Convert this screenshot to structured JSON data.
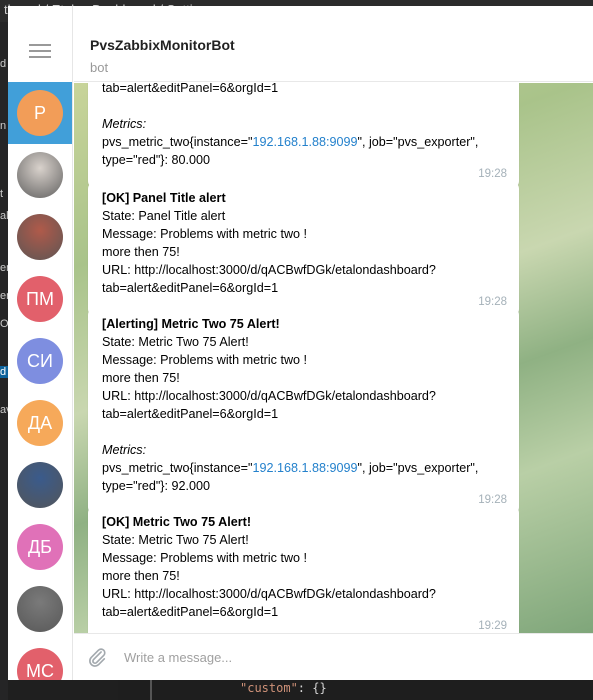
{
  "background": {
    "titlebar_text": "tboard / Etalon Dashboard / Setti",
    "edge_letters": [
      "d",
      "n",
      "t",
      "al",
      "er",
      "er",
      "O",
      "d",
      "av"
    ],
    "code_key": "\"custom\"",
    "code_punct": ": {}"
  },
  "chat": {
    "title": "PvsZabbixMonitorBot",
    "subtitle": "bot"
  },
  "sidebar": {
    "items": [
      {
        "initials": "P",
        "color": "#f29d58",
        "active": true
      },
      {
        "initials": "",
        "color": "#d9d2cc",
        "photo": "photo-hands"
      },
      {
        "initials": "",
        "color": "#b05a4a",
        "photo": "photo-person-sunglasses"
      },
      {
        "initials": "ПМ",
        "color": "#e2606b"
      },
      {
        "initials": "СИ",
        "color": "#7e8ee0"
      },
      {
        "initials": "ДА",
        "color": "#f6a95a"
      },
      {
        "initials": "",
        "color": "#3a5b8c",
        "photo": "photo-person-suit"
      },
      {
        "initials": "ДБ",
        "color": "#e071b8"
      },
      {
        "initials": "",
        "color": "#7a7a7a",
        "photo": "photo-grey-room"
      },
      {
        "initials": "МС",
        "color": "#e2606b"
      }
    ]
  },
  "messages": [
    {
      "lines": [
        {
          "text": "tab=alert&editPanel=6&orgId=1",
          "style": "normal"
        },
        {
          "text": "",
          "style": "spacer"
        },
        {
          "text": "Metrics:",
          "style": "italic"
        },
        {
          "text": "pvs_metric_two{instance=\"",
          "style": "metric",
          "link": "192.168.1.88:9099",
          "rest": "\", job=\"pvs_exporter\","
        },
        {
          "text": "type=\"red\"}: 80.000",
          "style": "normal"
        }
      ],
      "time": "19:28"
    },
    {
      "lines": [
        {
          "text": "[OK] Panel Title alert",
          "style": "bold"
        },
        {
          "text": "State: Panel Title alert",
          "style": "normal"
        },
        {
          "text": "Message: Problems with metric two !",
          "style": "normal"
        },
        {
          "text": "more then 75!",
          "style": "normal"
        },
        {
          "text": "URL: http://localhost:3000/d/qACBwfDGk/etalondashboard?",
          "style": "normal"
        },
        {
          "text": "tab=alert&editPanel=6&orgId=1",
          "style": "normal"
        }
      ],
      "time": "19:28"
    },
    {
      "lines": [
        {
          "text": "[Alerting] Metric Two 75 Alert!",
          "style": "bold"
        },
        {
          "text": "State: Metric Two 75 Alert!",
          "style": "normal"
        },
        {
          "text": "Message: Problems with metric two !",
          "style": "normal"
        },
        {
          "text": "more then 75!",
          "style": "normal"
        },
        {
          "text": "URL: http://localhost:3000/d/qACBwfDGk/etalondashboard?",
          "style": "normal"
        },
        {
          "text": "tab=alert&editPanel=6&orgId=1",
          "style": "normal"
        },
        {
          "text": "",
          "style": "spacer"
        },
        {
          "text": "Metrics:",
          "style": "italic"
        },
        {
          "text": "pvs_metric_two{instance=\"",
          "style": "metric",
          "link": "192.168.1.88:9099",
          "rest": "\", job=\"pvs_exporter\","
        },
        {
          "text": "type=\"red\"}: 92.000",
          "style": "normal"
        }
      ],
      "time": "19:28"
    },
    {
      "lines": [
        {
          "text": "[OK] Metric Two 75 Alert!",
          "style": "bold"
        },
        {
          "text": "State: Metric Two 75 Alert!",
          "style": "normal"
        },
        {
          "text": "Message: Problems with metric two !",
          "style": "normal"
        },
        {
          "text": "more then 75!",
          "style": "normal"
        },
        {
          "text": "URL: http://localhost:3000/d/qACBwfDGk/etalondashboard?",
          "style": "normal"
        },
        {
          "text": "tab=alert&editPanel=6&orgId=1",
          "style": "normal"
        }
      ],
      "time": "19:29"
    }
  ],
  "composer": {
    "placeholder": "Write a message..."
  }
}
